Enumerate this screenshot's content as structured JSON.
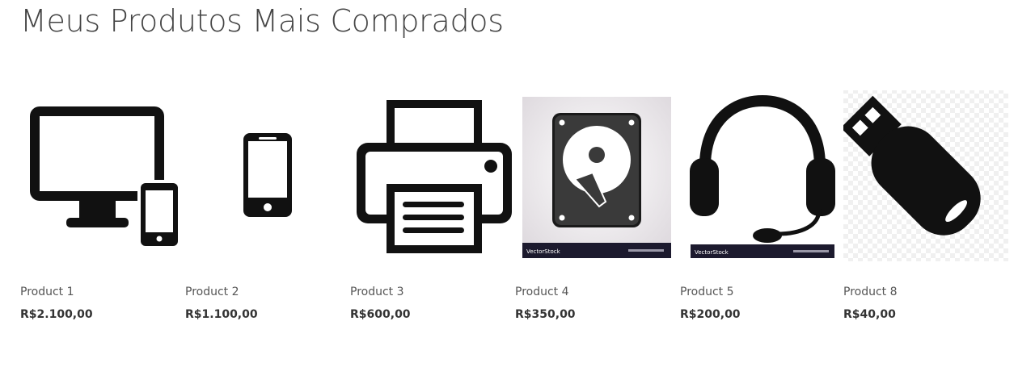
{
  "header": {
    "title": "Meus Produtos Mais Comprados"
  },
  "products": [
    {
      "name": "Product 1",
      "price": "R$2.100,00",
      "icon": "desktop-and-phone-icon"
    },
    {
      "name": "Product 2",
      "price": "R$1.100,00",
      "icon": "smartphone-icon"
    },
    {
      "name": "Product 3",
      "price": "R$600,00",
      "icon": "printer-icon"
    },
    {
      "name": "Product 4",
      "price": "R$350,00",
      "icon": "hard-drive-icon",
      "watermark": "VectorStock"
    },
    {
      "name": "Product 5",
      "price": "R$200,00",
      "icon": "headset-icon",
      "watermark": "VectorStock"
    },
    {
      "name": "Product 8",
      "price": "R$40,00",
      "icon": "usb-drive-icon"
    }
  ],
  "colors": {
    "icon": "#111111",
    "title": "#444444",
    "watermark_bar": "#1c1a2e"
  }
}
